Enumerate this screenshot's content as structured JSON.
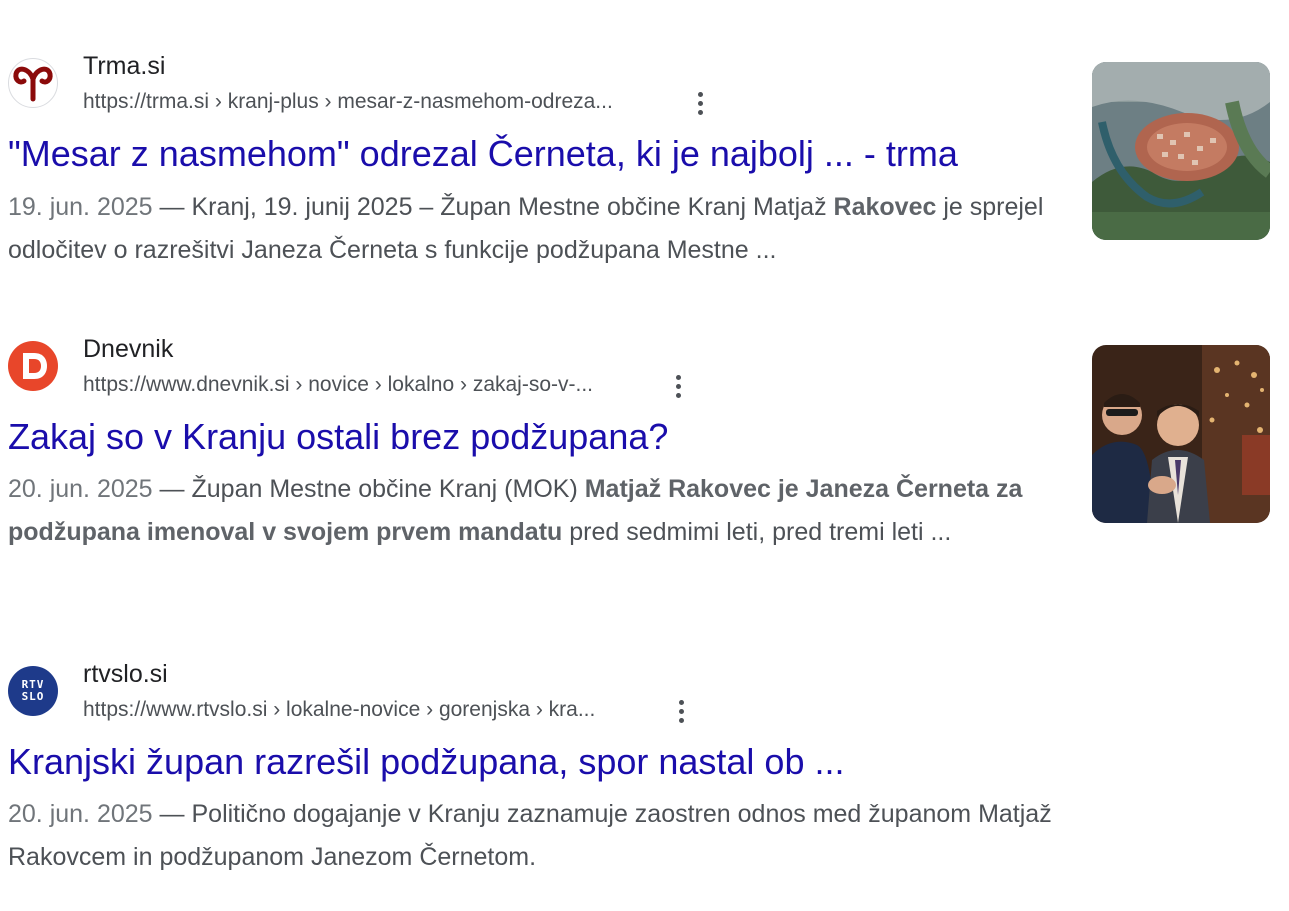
{
  "results": [
    {
      "site_name": "Trma.si",
      "url": "https://trma.si › kranj-plus › mesar-z-nasmehom-odreza...",
      "title": "\"Mesar z nasmehom\" odrezal Černeta, ki je najbolj ... - trma",
      "date": "19. jun. 2025",
      "snippet_a": "Kranj, 19. junij 2025 – Župan Mestne občine Kranj Matjaž ",
      "snippet_bold": "Rakovec",
      "snippet_b": " je sprejel odločitev o razrešitvi Janeza Černeta s funkcije podžupana Mestne ...",
      "favicon": "ram-horns-icon",
      "thumbnail": "aerial-town-photo"
    },
    {
      "site_name": "Dnevnik",
      "url": "https://www.dnevnik.si › novice › lokalno › zakaj-so-v-...",
      "title": "Zakaj so v Kranju ostali brez podžupana?",
      "date": "20. jun. 2025",
      "snippet_a": "Župan Mestne občine Kranj (MOK) ",
      "snippet_bold": "Matjaž Rakovec je Janeza Černeta za podžupana imenoval v svojem prvem mandatu",
      "snippet_b": " pred sedmimi leti, pred tremi leti ...",
      "favicon": "dnevnik-d-icon",
      "thumbnail": "two-men-photo"
    },
    {
      "site_name": "rtvslo.si",
      "url": "https://www.rtvslo.si › lokalne-novice › gorenjska › kra...",
      "title": "Kranjski župan razrešil podžupana, spor nastal ob ...",
      "date": "20. jun. 2025",
      "snippet_a": "Politično dogajanje v Kranju zaznamuje zaostren odnos med županom Matjaž Rakovcem in podžupanom Janezom Černetom.",
      "favicon": "rtv-slo-icon",
      "favicon_text_top": "RTV",
      "favicon_text_bottom": "SLO"
    }
  ],
  "separator": " — ",
  "colors": {
    "link": "#1a0dab",
    "text": "#4d5156",
    "site": "#202124",
    "trma_red": "#8b0a0a",
    "dnevnik_orange": "#e8462a",
    "rtv_blue": "#1e3a8a"
  }
}
